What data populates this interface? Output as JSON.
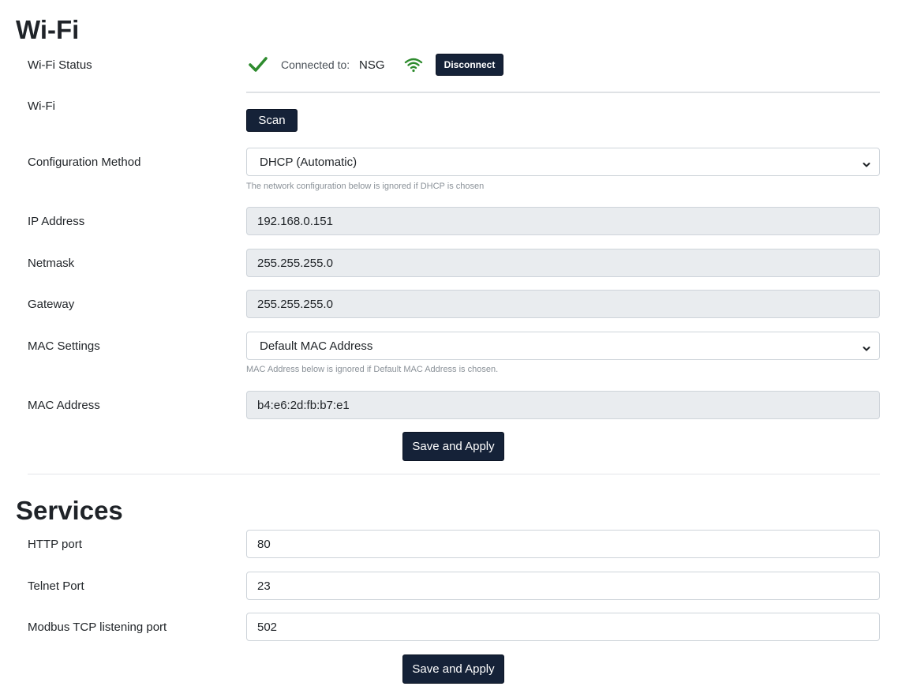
{
  "wifi": {
    "heading": "Wi-Fi",
    "status_label": "Wi-Fi Status",
    "connected_to_label": "Connected to:",
    "ssid": "NSG",
    "disconnect_label": "Disconnect",
    "wifi_label": "Wi-Fi",
    "scan_label": "Scan",
    "config_method_label": "Configuration Method",
    "config_method_value": "DHCP (Automatic)",
    "config_method_hint": "The network configuration below is ignored if DHCP is chosen",
    "ip_label": "IP Address",
    "ip_value": "192.168.0.151",
    "netmask_label": "Netmask",
    "netmask_value": "255.255.255.0",
    "gateway_label": "Gateway",
    "gateway_value": "255.255.255.0",
    "mac_settings_label": "MAC Settings",
    "mac_settings_value": "Default MAC Address",
    "mac_settings_hint": "MAC Address below is ignored if Default MAC Address is chosen.",
    "mac_address_label": "MAC Address",
    "mac_address_value": "b4:e6:2d:fb:b7:e1",
    "save_label": "Save and Apply",
    "status_color": "#2e8b2e"
  },
  "services": {
    "heading": "Services",
    "http_label": "HTTP port",
    "http_value": "80",
    "telnet_label": "Telnet Port",
    "telnet_value": "23",
    "modbus_label": "Modbus TCP listening port",
    "modbus_value": "502",
    "save_label": "Save and Apply"
  }
}
